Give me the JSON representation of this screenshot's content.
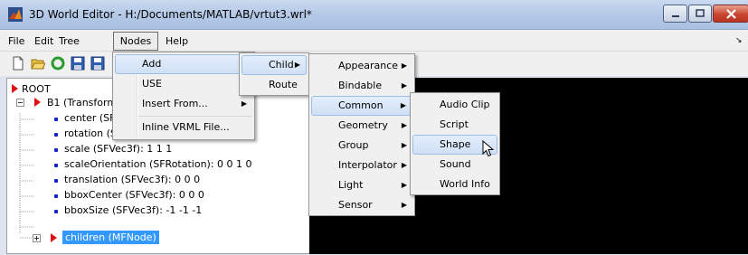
{
  "window": {
    "title": "3D World Editor - H:/Documents/MATLAB/vrtut3.wrl*"
  },
  "menubar": {
    "file": "File",
    "edit": "Edit",
    "tree": "Tree",
    "nodes": "Nodes",
    "help": "Help"
  },
  "tree": {
    "root": "ROOT",
    "b1": "B1 (Transform",
    "fields": [
      "center (SF",
      "rotation (SFRotation): 0 0 1 0",
      "scale (SFVec3f): 1 1 1",
      "scaleOrientation (SFRotation): 0 0 1 0",
      "translation (SFVec3f): 0 0 0",
      "bboxCenter (SFVec3f): 0 0 0",
      "bboxSize (SFVec3f): -1 -1 -1"
    ],
    "children": "children (MFNode)"
  },
  "menus": {
    "nodes": {
      "items": [
        "Add",
        "USE",
        "Insert From...",
        "Inline VRML File..."
      ]
    },
    "add": {
      "items": [
        "Child",
        "Route"
      ]
    },
    "child": {
      "items": [
        "Appearance",
        "Bindable",
        "Common",
        "Geometry",
        "Group",
        "Interpolator",
        "Light",
        "Sensor"
      ]
    },
    "common": {
      "items": [
        "Audio Clip",
        "Script",
        "Shape",
        "Sound",
        "World Info"
      ]
    }
  },
  "icons": {
    "app": "matlab-logo-icon",
    "toolbar": [
      "new-icon",
      "open-icon",
      "refresh-icon",
      "save-icon",
      "save-as-icon"
    ],
    "window": [
      "minimize-icon",
      "maximize-icon",
      "close-icon"
    ]
  },
  "colors": {
    "root_arrow": "#e01010",
    "field_dot": "#1420c8",
    "selection": "#3399ff",
    "viewer": "#000000"
  }
}
